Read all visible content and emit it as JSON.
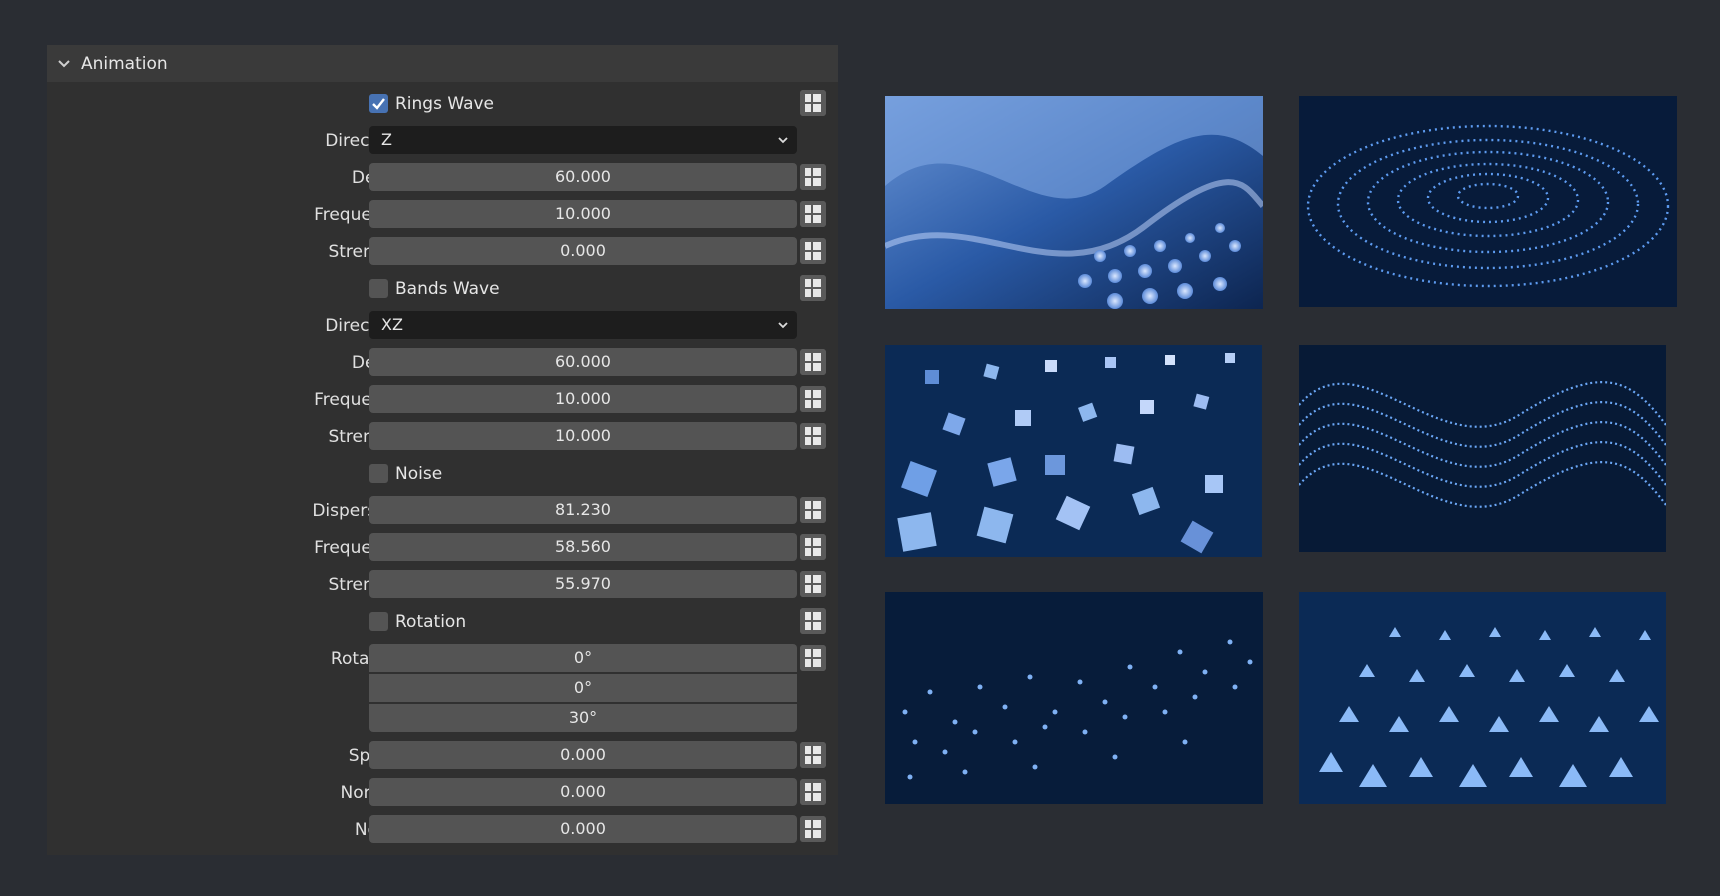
{
  "panel": {
    "title": "Animation"
  },
  "rings_wave": {
    "label": "Rings Wave",
    "checked": true,
    "direction_label": "Direction",
    "direction_value": "Z",
    "detail_label": "Detail",
    "detail_value": "60.000",
    "frequency_label": "Frequency",
    "frequency_value": "10.000",
    "strength_label": "Strength",
    "strength_value": "0.000"
  },
  "bands_wave": {
    "label": "Bands Wave",
    "checked": false,
    "direction_label": "Direction",
    "direction_value": "XZ",
    "detail_label": "Detail",
    "detail_value": "60.000",
    "frequency_label": "Frequency",
    "frequency_value": "10.000",
    "strength_label": "Strength",
    "strength_value": "10.000"
  },
  "noise": {
    "label": "Noise",
    "checked": false,
    "dispersion_label": "Dispersion",
    "dispersion_value": "81.230",
    "frequency_label": "Frequency",
    "frequency_value": "58.560",
    "strength_label": "Strength",
    "strength_value": "55.970"
  },
  "rotation": {
    "label": "Rotation",
    "checked": false,
    "rotation_label": "Rotation",
    "x_value": "0°",
    "y_value": "0°",
    "z_value": "30°",
    "speed_label": "Speed",
    "speed_value": "0.000",
    "normal_label": "Normal",
    "normal_value": "0.000",
    "noise_label": "Noise",
    "noise_value": "0.000"
  },
  "colors": {
    "accent": "#4772b3",
    "panel": "#303030",
    "field": "#545454",
    "background": "#2a2d33"
  },
  "icons": {
    "collapse": "chevron-down-icon",
    "keyframe": "keyframe-icon",
    "dropdown": "chevron-down-icon"
  }
}
